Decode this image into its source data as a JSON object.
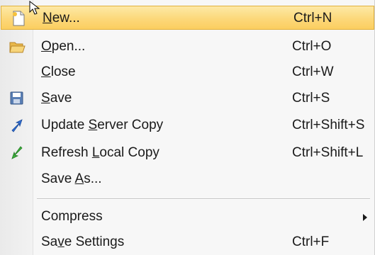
{
  "menu": {
    "items": [
      {
        "id": "new",
        "pre": "",
        "mn": "N",
        "post": "ew...",
        "shortcut": "Ctrl+N",
        "icon": "new-document-icon",
        "highlighted": true
      },
      {
        "id": "open",
        "pre": "",
        "mn": "O",
        "post": "pen...",
        "shortcut": "Ctrl+O",
        "icon": "open-folder-icon"
      },
      {
        "id": "close",
        "pre": "",
        "mn": "C",
        "post": "lose",
        "shortcut": "Ctrl+W",
        "icon": ""
      },
      {
        "id": "save",
        "pre": "",
        "mn": "S",
        "post": "ave",
        "shortcut": "Ctrl+S",
        "icon": "save-disk-icon"
      },
      {
        "id": "update-server-copy",
        "pre": "Update ",
        "mn": "S",
        "post": "erver Copy",
        "shortcut": "Ctrl+Shift+S",
        "icon": "upload-arrow-icon"
      },
      {
        "id": "refresh-local-copy",
        "pre": "Refresh ",
        "mn": "L",
        "post": "ocal Copy",
        "shortcut": "Ctrl+Shift+L",
        "icon": "download-arrow-icon"
      },
      {
        "id": "save-as",
        "pre": "Save ",
        "mn": "A",
        "post": "s...",
        "shortcut": "",
        "icon": ""
      },
      {
        "id": "compress",
        "pre": "Compress",
        "mn": "",
        "post": "",
        "shortcut": "",
        "icon": "",
        "submenu": true
      },
      {
        "id": "save-settings",
        "pre": "Sa",
        "mn": "v",
        "post": "e Settings",
        "shortcut": "Ctrl+F",
        "icon": ""
      }
    ]
  },
  "colors": {
    "highlight": "#fcd87a",
    "highlight_border": "#e1b13b",
    "menu_background": "#f7f7f7",
    "text": "#1a1a1a"
  }
}
